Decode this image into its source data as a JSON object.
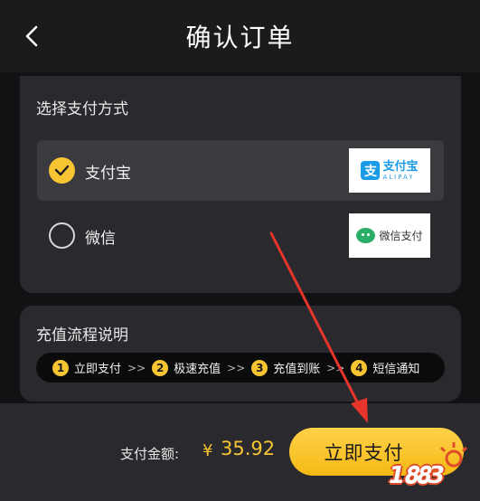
{
  "header": {
    "title": "确认订单"
  },
  "payment": {
    "section_title": "选择支付方式",
    "options": [
      {
        "label": "支付宝",
        "selected": true,
        "logo_cn": "支付宝",
        "logo_en": "ALIPAY",
        "logo_mark": "支"
      },
      {
        "label": "微信",
        "selected": false,
        "logo_cn": "微信支付"
      }
    ]
  },
  "flow": {
    "section_title": "充值流程说明",
    "steps": [
      {
        "num": "1",
        "label": "立即支付"
      },
      {
        "num": "2",
        "label": "极速充值"
      },
      {
        "num": "3",
        "label": "充值到账"
      },
      {
        "num": "4",
        "label": "短信通知"
      }
    ],
    "separator": ">>"
  },
  "footer": {
    "amount_label": "支付金额:",
    "currency_symbol": "¥",
    "amount": "35.92",
    "pay_button": "立即支付"
  },
  "watermark": {
    "text": "1𝟖𝟖3"
  },
  "colors": {
    "accent": "#f7c531",
    "background": "#1b1b1d",
    "card": "#2a2a2e",
    "annotation_arrow": "#e8352b"
  },
  "icons": {
    "back": "chevron-left-icon",
    "check": "check-icon",
    "annotation": "red-arrow-icon"
  }
}
